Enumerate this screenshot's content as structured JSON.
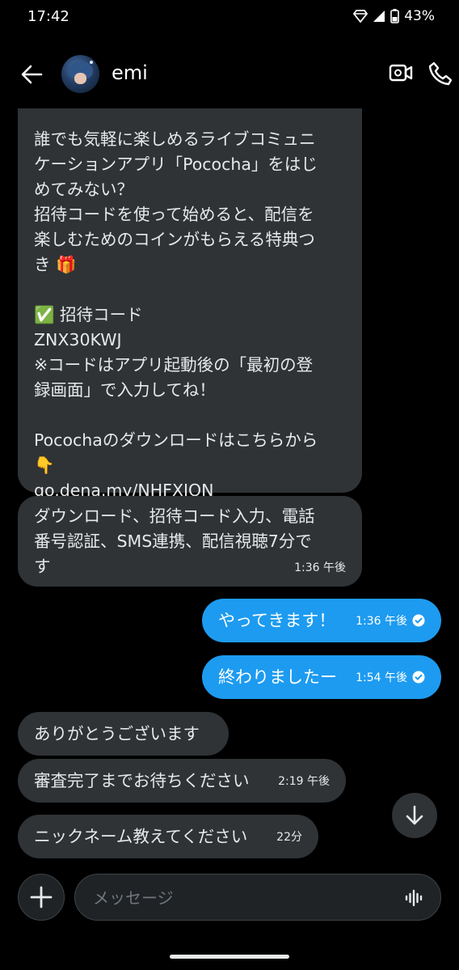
{
  "status_bar": {
    "time": "17:42",
    "battery": "43%"
  },
  "header": {
    "contact_name": "emi"
  },
  "messages": [
    {
      "direction": "in",
      "text": "誰でも気軽に楽しめるライブコミュニ\nケーションアプリ「Pococha」をはじ\nめてみない？\n招待コードを使って始めると、配信を\n楽しむためのコインがもらえる特典つ\nき 🎁\n\n✅ 招待コード\nZNX30KWJ\n※コードはアプリ起動後の「最初の登\n録画面」で入力してね！\n\nPocochaのダウンロードはこちらから\n👇",
      "link": "go.dena.my/NHFXJQN"
    },
    {
      "direction": "in",
      "text": "ダウンロード、招待コード入力、電話\n番号認証、SMS連携、配信視聴7分で\nす",
      "time": "1:36 午後"
    },
    {
      "direction": "out",
      "text": "やってきます！",
      "time": "1:36 午後"
    },
    {
      "direction": "out",
      "text": "終わりましたー",
      "time": "1:54 午後"
    },
    {
      "direction": "in",
      "text": "ありがとうございます"
    },
    {
      "direction": "in",
      "text": "審査完了までお待ちください",
      "time": "2:19 午後"
    },
    {
      "direction": "in",
      "text": "ニックネーム教えてください",
      "time": "22分"
    }
  ],
  "composer": {
    "placeholder": "メッセージ"
  },
  "colors": {
    "accent": "#1d9bf0",
    "bubble_in": "#2f3336",
    "background": "#000000"
  }
}
